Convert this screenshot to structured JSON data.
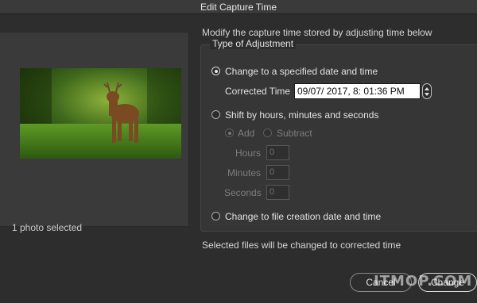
{
  "window": {
    "title": "Edit Capture Time"
  },
  "preview": {
    "selection_text": "1 photo selected"
  },
  "description": "Modify the capture time stored by adjusting time below",
  "adjustment": {
    "group_title": "Type of Adjustment",
    "option_specified": "Change to a specified date and time",
    "corrected_time_label": "Corrected Time",
    "corrected_time_value": "09/07/ 2017,   8: 01:36 PM",
    "option_shift": "Shift by hours, minutes and seconds",
    "add_label": "Add",
    "subtract_label": "Subtract",
    "hours_label": "Hours",
    "hours_value": "0",
    "minutes_label": "Minutes",
    "minutes_value": "0",
    "seconds_label": "Seconds",
    "seconds_value": "0",
    "option_file_creation": "Change to file creation date and time"
  },
  "footer_note": "Selected files will be changed to corrected time",
  "buttons": {
    "cancel": "Cancel",
    "change": "Change"
  },
  "watermark": "ITMOP.COM",
  "colors": {
    "background": "#2d2d2d",
    "panel": "#3a3a3a",
    "text": "#d9d9d9"
  }
}
